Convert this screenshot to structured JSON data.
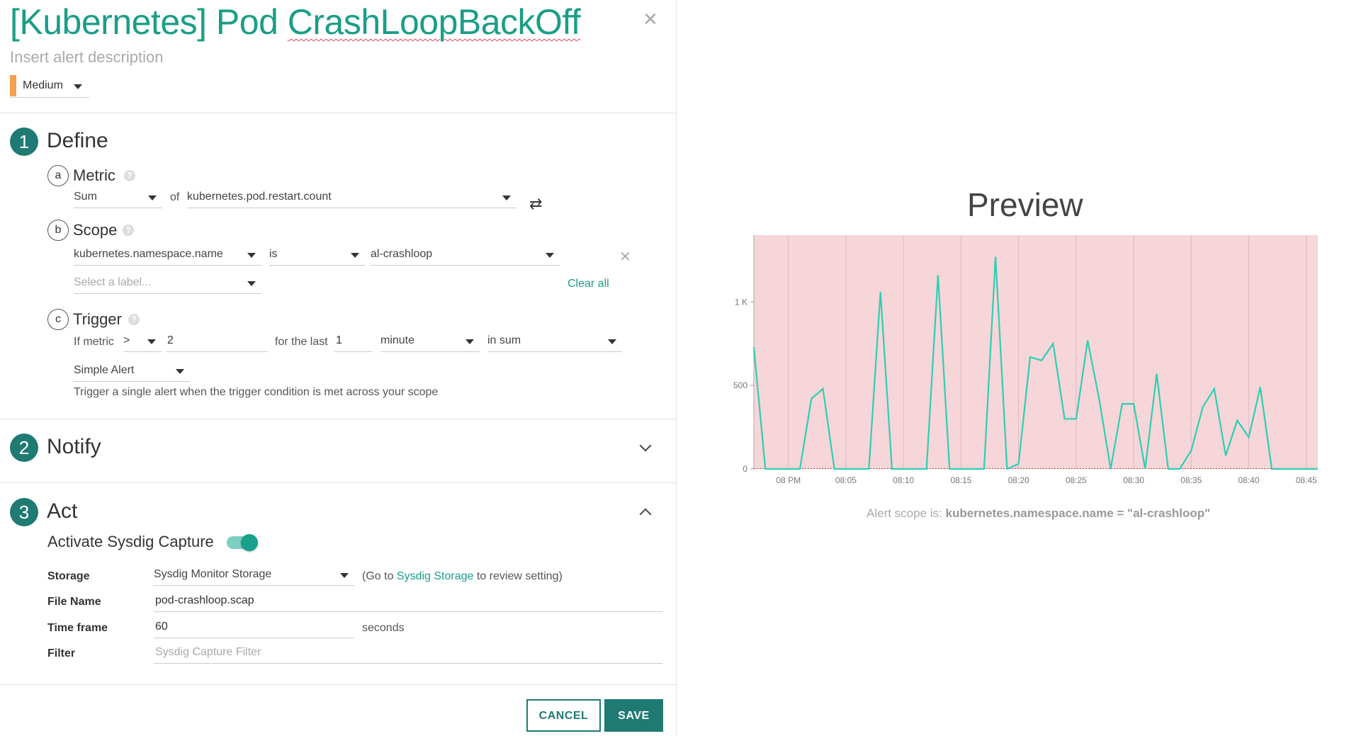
{
  "alert": {
    "title_prefix": "[Kubernetes] Pod ",
    "title_main": "CrashLoopBackOff",
    "description_placeholder": "Insert alert description",
    "severity": "Medium",
    "severity_color": "#f5a04a"
  },
  "define": {
    "num": "1",
    "title": "Define",
    "metric": {
      "letter": "a",
      "title": "Metric",
      "aggregation": "Sum",
      "of_label": "of",
      "metric_name": "kubernetes.pod.restart.count"
    },
    "scope": {
      "letter": "b",
      "title": "Scope",
      "label": "kubernetes.namespace.name",
      "operator": "is",
      "value": "al-crashloop",
      "add_placeholder": "Select a label...",
      "clear_all": "Clear all"
    },
    "trigger": {
      "letter": "c",
      "title": "Trigger",
      "if_metric": "If metric",
      "comparator": ">",
      "threshold": "2",
      "for_the_last": "for the last",
      "duration": "1",
      "unit": "minute",
      "mode": "in sum",
      "alert_type": "Simple Alert",
      "alert_type_desc": "Trigger a single alert when the trigger condition is met across your scope"
    }
  },
  "notify": {
    "num": "2",
    "title": "Notify"
  },
  "act": {
    "num": "3",
    "title": "Act",
    "capture_label": "Activate Sysdig Capture",
    "capture_enabled": true,
    "storage_label": "Storage",
    "storage_value": "Sysdig Monitor Storage",
    "storage_note_pre": "(Go to ",
    "storage_note_link": "Sysdig Storage",
    "storage_note_post": " to review setting)",
    "filename_label": "File Name",
    "filename_value": "pod-crashloop.scap",
    "timeframe_label": "Time frame",
    "timeframe_value": "60",
    "timeframe_unit": "seconds",
    "filter_label": "Filter",
    "filter_placeholder": "Sysdig Capture Filter"
  },
  "buttons": {
    "cancel": "CANCEL",
    "save": "SAVE"
  },
  "preview": {
    "title": "Preview",
    "scope_note_pre": "Alert scope is: ",
    "scope_note_expr": "kubernetes.namespace.name = \"al-crashloop\""
  },
  "chart_data": {
    "type": "line",
    "x_labels": [
      "08 PM",
      "08:05",
      "08:10",
      "08:15",
      "08:20",
      "08:25",
      "08:30",
      "08:35",
      "08:40",
      "08:45"
    ],
    "y_ticks": [
      {
        "value": 0,
        "label": "0"
      },
      {
        "value": 500,
        "label": "500"
      },
      {
        "value": 1000,
        "label": "1 K"
      }
    ],
    "ylim": [
      0,
      1400
    ],
    "xlim": [
      -3,
      46
    ],
    "threshold": 2,
    "background_color": "#f6d6d9",
    "line_color": "#2ecfb1",
    "series": [
      {
        "x": [
          -3,
          -2,
          -1,
          0,
          1,
          2,
          3,
          4,
          5,
          6,
          7,
          8,
          9,
          10,
          11,
          12,
          13,
          14,
          15,
          16,
          17,
          18,
          19,
          20,
          21,
          22,
          23,
          24,
          25,
          26,
          27,
          28,
          29,
          30,
          31,
          32,
          33,
          34,
          35,
          36,
          37,
          38,
          39,
          40,
          41,
          42,
          43,
          44,
          45,
          46
        ],
        "values": [
          730,
          0,
          0,
          0,
          0,
          420,
          480,
          0,
          0,
          0,
          0,
          1060,
          0,
          0,
          0,
          0,
          1160,
          0,
          0,
          0,
          0,
          1270,
          0,
          30,
          670,
          650,
          750,
          300,
          300,
          770,
          420,
          0,
          390,
          390,
          0,
          570,
          0,
          0,
          110,
          370,
          480,
          80,
          290,
          190,
          490,
          0,
          0,
          0,
          0,
          0
        ]
      }
    ]
  }
}
